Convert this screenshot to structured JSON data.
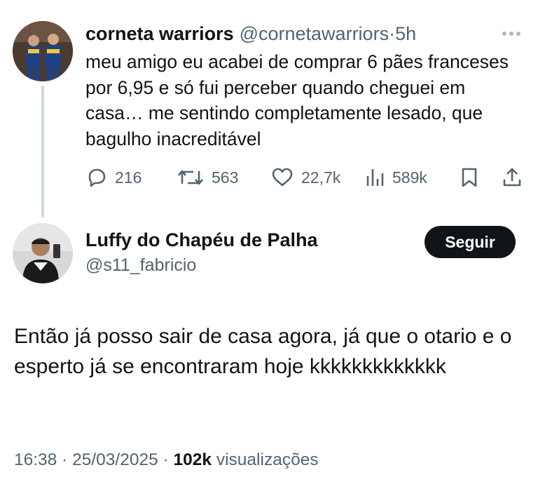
{
  "tweet": {
    "author_name": "corneta warriors",
    "author_handle": "@cornetawarriors",
    "separator": "·",
    "time": "5h",
    "text": "meu amigo eu acabei de comprar 6 pães franceses por 6,95 e só fui perceber quando cheguei em casa… me sentindo completamente lesado, que bagulho inacreditável",
    "actions": {
      "replies": "216",
      "reposts": "563",
      "likes": "22,7k",
      "views": "589k"
    }
  },
  "reply": {
    "author_name": "Luffy do Chapéu de Palha",
    "author_handle": "@s11_fabricio",
    "follow_label": "Seguir",
    "text": "Então já posso sair de casa agora, já que o otario e o esperto já se encontraram hoje kkkkkkkkkkkkk",
    "time": "16:38",
    "date": "25/03/2025",
    "separator": "·",
    "views_count": "102k",
    "views_label": "visualizações"
  },
  "icons": [
    "more-icon",
    "reply-icon",
    "repost-icon",
    "like-icon",
    "views-icon",
    "bookmark-icon",
    "share-icon"
  ],
  "colors": {
    "text": "#0f1419",
    "secondary": "#536471",
    "follow_bg": "#0f1419",
    "thread_line": "#cfd9de"
  }
}
